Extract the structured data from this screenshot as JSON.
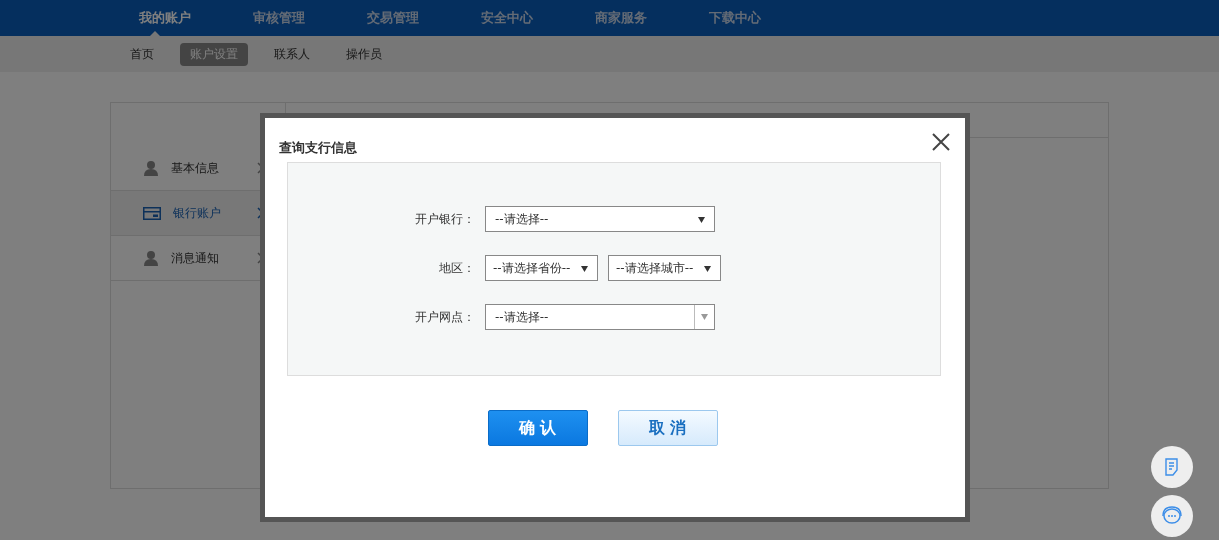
{
  "nav": [
    {
      "label": "我的账户",
      "selected": true
    },
    {
      "label": "审核管理",
      "selected": false
    },
    {
      "label": "交易管理",
      "selected": false
    },
    {
      "label": "安全中心",
      "selected": false
    },
    {
      "label": "商家服务",
      "selected": false
    },
    {
      "label": "下载中心",
      "selected": false
    }
  ],
  "subnav": [
    {
      "label": "首页",
      "selected": false
    },
    {
      "label": "账户设置",
      "selected": true
    },
    {
      "label": "联系人",
      "selected": false
    },
    {
      "label": "操作员",
      "selected": false
    }
  ],
  "sidebar": {
    "items": [
      {
        "label": "基本信息",
        "kind": "person",
        "selected": false
      },
      {
        "label": "银行账户",
        "kind": "card",
        "selected": true
      },
      {
        "label": "消息通知",
        "kind": "person",
        "selected": false
      }
    ]
  },
  "dialog": {
    "title": "查询支行信息",
    "rows": [
      {
        "label": "开户银行：",
        "fields": [
          {
            "kind": "select",
            "value": "--请选择--"
          }
        ]
      },
      {
        "label": "地区：",
        "fields": [
          {
            "kind": "select",
            "value": "--请选择省份--"
          },
          {
            "kind": "select",
            "value": "--请选择城市--"
          }
        ]
      },
      {
        "label": "开户网点：",
        "fields": [
          {
            "kind": "combo",
            "value": "--请选择--"
          }
        ]
      }
    ],
    "buttons": [
      {
        "label": "确 认",
        "kind": "primary"
      },
      {
        "label": "取 消",
        "kind": "secondary"
      }
    ]
  }
}
